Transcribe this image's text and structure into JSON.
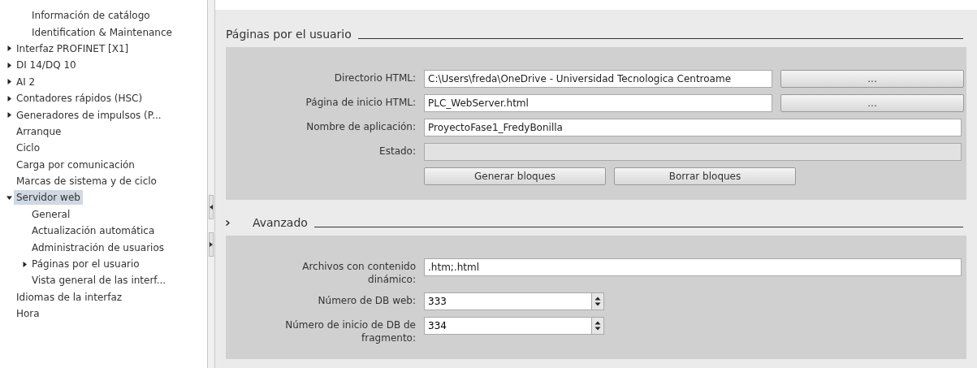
{
  "sidebar": {
    "orphan_children": [
      {
        "label": "Información de catálogo",
        "selected": false
      },
      {
        "label": "Identification & Maintenance",
        "selected": false
      }
    ],
    "items": [
      {
        "label": "Interfaz PROFINET [X1]",
        "selected": false,
        "expanded": false
      },
      {
        "label": "DI 14/DQ 10",
        "selected": false,
        "expanded": false
      },
      {
        "label": "AI 2",
        "selected": false,
        "expanded": false
      },
      {
        "label": "Contadores rápidos (HSC)",
        "selected": false,
        "expanded": false
      },
      {
        "label": "Generadores de impulsos (P...",
        "selected": false,
        "expanded": false
      },
      {
        "label": "Arranque",
        "selected": false
      },
      {
        "label": "Ciclo",
        "selected": false
      },
      {
        "label": "Carga por comunicación",
        "selected": false
      },
      {
        "label": "Marcas de sistema y de ciclo",
        "selected": false
      },
      {
        "label": "Servidor web",
        "selected": true,
        "expanded": true,
        "children": [
          {
            "label": "General",
            "selected": false
          },
          {
            "label": "Actualización automática",
            "selected": false
          },
          {
            "label": "Administración de usuarios",
            "selected": false
          },
          {
            "label": "Páginas por el usuario",
            "selected": false,
            "expanded": false
          },
          {
            "label": "Vista general de las interf...",
            "selected": false
          }
        ]
      },
      {
        "label": "Idiomas de la interfaz",
        "selected": false
      },
      {
        "label": "Hora",
        "selected": false
      }
    ]
  },
  "sections": [
    {
      "title": "Páginas por el usuario",
      "collapsible": false,
      "fields": [
        {
          "kind": "text",
          "label": "Directorio HTML:",
          "value": "C:\\Users\\freda\\OneDrive - Universidad Tecnologica Centroame",
          "button": "..."
        },
        {
          "kind": "text",
          "label": "Página de inicio HTML:",
          "value": "PLC_WebServer.html",
          "button": "..."
        },
        {
          "kind": "text",
          "label": "Nombre de aplicación:",
          "value": "ProyectoFase1_FredyBonilla"
        },
        {
          "kind": "readonly",
          "label": "Estado:"
        },
        {
          "kind": "buttons",
          "buttons": [
            "Generar bloques",
            "Borrar bloques"
          ]
        }
      ]
    },
    {
      "title": "Avanzado",
      "collapsible": true,
      "fields": [
        {
          "kind": "text",
          "label": "Archivos con contenido dinámico:",
          "value": ".htm;.html"
        },
        {
          "kind": "spin",
          "label": "Número de DB web:",
          "value": "333"
        },
        {
          "kind": "spin",
          "label": "Número de inicio de DB de fragmento:",
          "value": "334"
        }
      ]
    }
  ]
}
